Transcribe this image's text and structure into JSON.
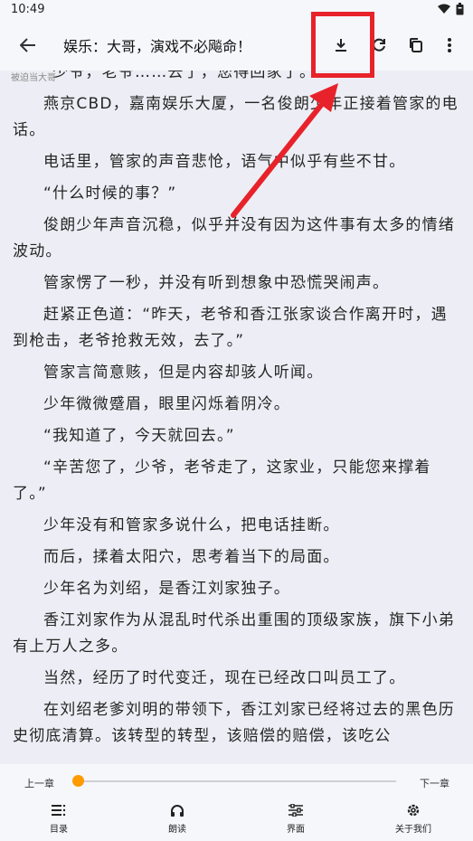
{
  "status": {
    "time": "10:49"
  },
  "appbar": {
    "title": "娱乐：大哥，演戏不必飚命！",
    "subtitle": "被迫当大哥"
  },
  "paragraphs": [
    "“少爷，老爷……去了，您得回家了。”",
    "燕京CBD，嘉南娱乐大厦，一名俊朗少年正接着管家的电话。",
    "电话里，管家的声音悲怆，语气中似乎有些不甘。",
    "“什么时候的事？”",
    "俊朗少年声音沉稳，似乎并没有因为这件事有太多的情绪波动。",
    "管家愣了一秒，并没有听到想象中恐慌哭闹声。",
    "赶紧正色道：“昨天，老爷和香江张家谈合作离开时，遇到枪击，老爷抢救无效，去了。”",
    "管家言简意赅，但是内容却骇人听闻。",
    "少年微微蹙眉，眼里闪烁着阴冷。",
    "“我知道了，今天就回去。”",
    "“辛苦您了，少爷，老爷走了，这家业，只能您来撑着了。”",
    "少年没有和管家多说什么，把电话挂断。",
    "而后，揉着太阳穴，思考着当下的局面。",
    "少年名为刘绍，是香江刘家独子。",
    "香江刘家作为从混乱时代杀出重围的顶级家族，旗下小弟有上万人之多。",
    "当然，经历了时代变迁，现在已经改口叫员工了。",
    "在刘绍老爹刘明的带领下，香江刘家已经将过去的黑色历史彻底清算。该转型的转型，该赔偿的赔偿，该吃公"
  ],
  "progress": {
    "prev_label": "上一章",
    "next_label": "下一章",
    "value": 0.0
  },
  "nav": [
    {
      "label": "目录",
      "icon": "toc-icon"
    },
    {
      "label": "朗读",
      "icon": "headphones-icon"
    },
    {
      "label": "界面",
      "icon": "sliders-icon"
    },
    {
      "label": "关于我们",
      "icon": "gear-icon"
    }
  ],
  "colors": {
    "accent": "#ff9a00",
    "highlight": "#e8222a",
    "background": "#edeef5"
  }
}
